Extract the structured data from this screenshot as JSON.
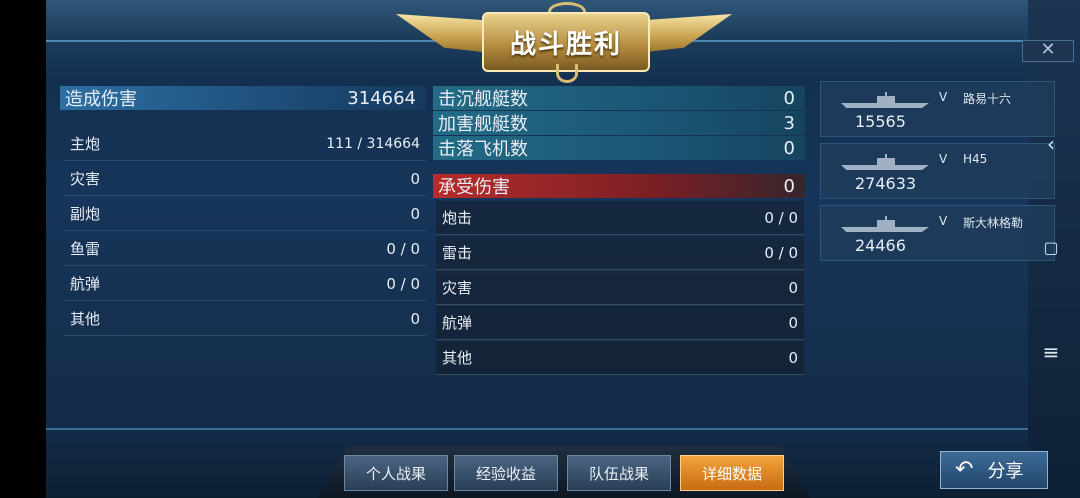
{
  "banner": {
    "title": "战斗胜利"
  },
  "close": {
    "glyph": "✕"
  },
  "damage_dealt": {
    "label": "造成伤害",
    "total": "314664",
    "rows": [
      {
        "label": "主炮",
        "value": "111 / 314664"
      },
      {
        "label": "灾害",
        "value": "0"
      },
      {
        "label": "副炮",
        "value": "0"
      },
      {
        "label": "鱼雷",
        "value": "0 / 0"
      },
      {
        "label": "航弹",
        "value": "0 / 0"
      },
      {
        "label": "其他",
        "value": "0"
      }
    ]
  },
  "kills": [
    {
      "label": "击沉舰艇数",
      "value": "0"
    },
    {
      "label": "加害舰艇数",
      "value": "3"
    },
    {
      "label": "击落飞机数",
      "value": "0"
    }
  ],
  "damage_taken": {
    "label": "承受伤害",
    "total": "0",
    "rows": [
      {
        "label": "炮击",
        "value": "0 / 0"
      },
      {
        "label": "雷击",
        "value": "0 / 0"
      },
      {
        "label": "灾害",
        "value": "0"
      },
      {
        "label": "航弹",
        "value": "0"
      },
      {
        "label": "其他",
        "value": "0"
      }
    ]
  },
  "targets": [
    {
      "rank": "V",
      "name": "路易十六",
      "damage": "15565"
    },
    {
      "rank": "V",
      "name": "H45",
      "damage": "274633"
    },
    {
      "rank": "V",
      "name": "斯大林格勒",
      "damage": "24466"
    }
  ],
  "tabs": [
    {
      "label": "个人战果"
    },
    {
      "label": "经验收益"
    },
    {
      "label": "队伍战果"
    },
    {
      "label": "详细数据"
    }
  ],
  "share": {
    "label": "分享"
  },
  "icons": {
    "back": "chevron-left-icon",
    "home": "square-icon",
    "menu": "menu-icon"
  }
}
